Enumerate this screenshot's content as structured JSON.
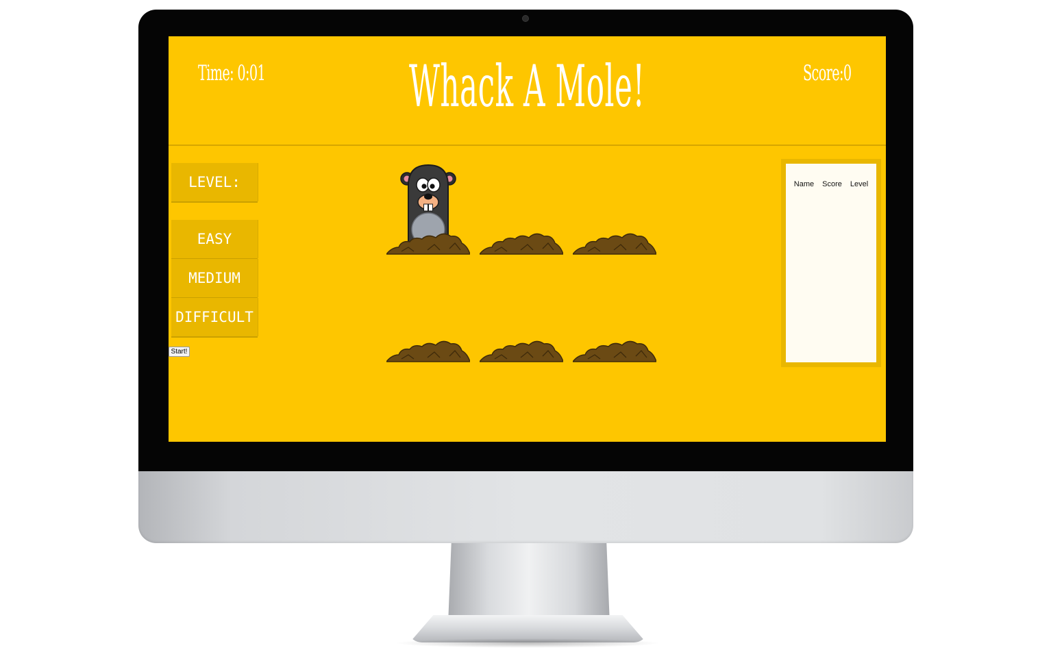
{
  "header": {
    "time": "Time: 0:01",
    "title": "Whack A Mole!",
    "score": "Score:0"
  },
  "sidebar": {
    "level_label": "LEVEL:",
    "levels": [
      "EASY",
      "MEDIUM",
      "DIFFICULT"
    ],
    "start_label": "Start!"
  },
  "game": {
    "rows": 2,
    "holes_per_row": 3,
    "mole_visible_in_hole": 1
  },
  "leaderboard": {
    "columns": [
      "Name",
      "Score",
      "Level"
    ],
    "rows": []
  },
  "colors": {
    "screen_bg": "#fec600",
    "button_bg": "#e9b700",
    "text": "#ffffff",
    "dirt": "#6b4a14"
  }
}
